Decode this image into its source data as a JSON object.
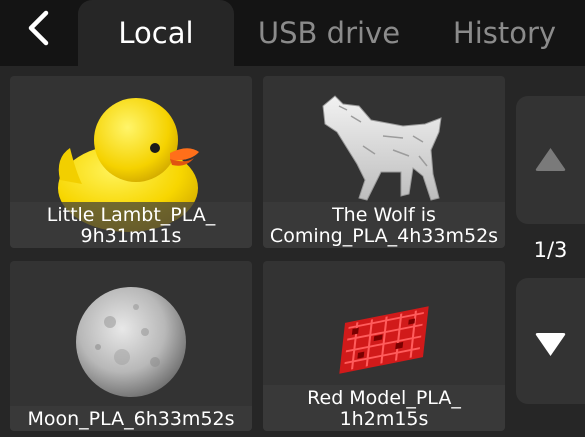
{
  "header": {
    "back_icon": "chevron-left-icon",
    "tabs": [
      {
        "label": "Local",
        "active": true
      },
      {
        "label": "USB drive",
        "active": false
      },
      {
        "label": "History",
        "active": false
      }
    ]
  },
  "files": [
    {
      "name": "Little Lambt_PLA_\n9h31m11s",
      "thumbnail": "yellow-duck-model"
    },
    {
      "name": "The Wolf is\nComing_PLA_4h33m52s",
      "thumbnail": "wolf-model"
    },
    {
      "name": "Moon_PLA_6h33m52s",
      "thumbnail": "moon-model"
    },
    {
      "name": "Red Model_PLA_\n1h2m15s",
      "thumbnail": "red-model"
    }
  ],
  "pager": {
    "up_icon": "triangle-up-icon",
    "down_icon": "triangle-down-icon",
    "page_indicator": "1/3",
    "up_enabled": false
  },
  "colors": {
    "background": "#151515",
    "panel": "#262626",
    "card": "#333333",
    "active_tab_text": "#ffffff",
    "inactive_tab_text": "#8b8b8b",
    "disabled_arrow": "#7a7a7a",
    "enabled_arrow": "#ffffff"
  }
}
